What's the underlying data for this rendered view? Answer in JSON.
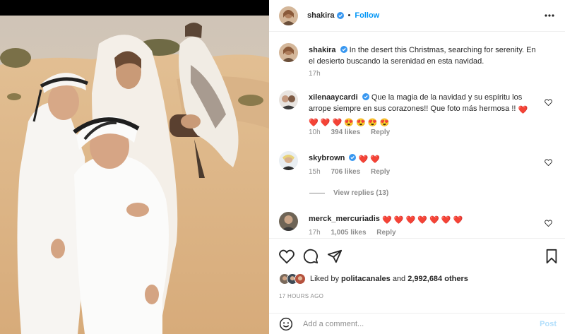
{
  "post": {
    "author": "shakira",
    "verified_icon": "verified-badge-icon",
    "separator": "•",
    "follow_label": "Follow",
    "more_icon": "more-options-icon"
  },
  "caption": {
    "user": "shakira",
    "text": "In the desert this Christmas, searching for serenity. En el desierto buscando la serenidad en esta navidad.",
    "time": "17h"
  },
  "comments": [
    {
      "user": "xilenaaycardi",
      "text": "Que la magia de la navidad y su espíritu los arrope siempre en sus corazones!! Que foto más hermosa !!",
      "emojis": [
        "❤️",
        "❤️",
        "❤️",
        "❤️",
        "😍",
        "😍",
        "😍",
        "😍"
      ],
      "time": "10h",
      "likes": "394 likes",
      "reply": "Reply"
    },
    {
      "user": "skybrown",
      "text": "",
      "emojis": [
        "❤️",
        "❤️"
      ],
      "time": "15h",
      "likes": "706 likes",
      "reply": "Reply",
      "view_replies": "View replies (13)"
    },
    {
      "user": "merck_mercuriadis",
      "text": "",
      "emojis": [
        "❤️",
        "❤️",
        "❤️",
        "❤️",
        "❤️",
        "❤️",
        "❤️"
      ],
      "time": "17h",
      "likes": "1,005 likes",
      "reply": "Reply"
    }
  ],
  "actions": {
    "like_icon": "heart-icon",
    "comment_icon": "comment-icon",
    "share_icon": "send-icon",
    "save_icon": "bookmark-icon"
  },
  "likes": {
    "prefix": "Liked by",
    "user": "politacanales",
    "and": "and",
    "count": "2,992,684 others"
  },
  "timestamp": "17 HOURS AGO",
  "add_comment": {
    "placeholder": "Add a comment...",
    "post_label": "Post",
    "emoji_icon": "smiley-icon"
  },
  "colors": {
    "link": "#0095f6",
    "heart": "#ed4956",
    "muted": "#8e8e8e",
    "post_disabled": "#b2dffc"
  }
}
